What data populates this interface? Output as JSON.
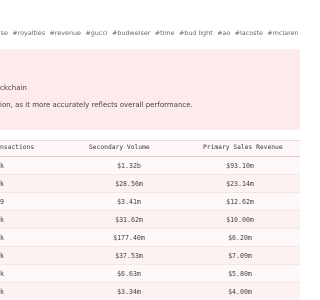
{
  "tags": [
    "rse",
    "#royalties",
    "#revenue",
    "#gucci",
    "#budweiser",
    "#time",
    "#bud light",
    "#ao",
    "#lacoste",
    "#mclaren",
    "#pepsi",
    "#min"
  ],
  "notice": {
    "line1": "ckchain",
    "line2": "ion, as it more accurately reflects overall performance."
  },
  "table": {
    "headers": [
      "nsactions",
      "Secondary Volume",
      "Primary Sales Revenue"
    ],
    "rows": [
      [
        "k",
        "$1.32b",
        "$93.10m"
      ],
      [
        "k",
        "$28.56m",
        "$23.14m"
      ],
      [
        "9",
        "$3.41m",
        "$12.62m"
      ],
      [
        "k",
        "$31.62m",
        "$10.00m"
      ],
      [
        "k",
        "$177.40m",
        "$6.20m"
      ],
      [
        "k",
        "$37.53m",
        "$7.09m"
      ],
      [
        "k",
        "$6.63m",
        "$5.80m"
      ],
      [
        "k",
        "$3.34m",
        "$4.00m"
      ]
    ]
  }
}
